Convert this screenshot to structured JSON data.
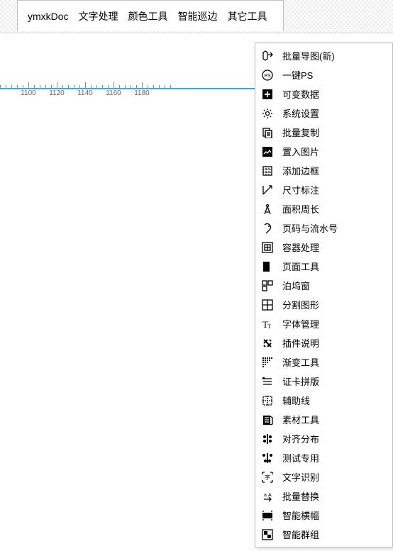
{
  "tab": {
    "doc_name": "ymxkDoc",
    "groups": [
      "文字处理",
      "颜色工具",
      "智能巡边",
      "其它工具"
    ]
  },
  "ruler": {
    "ticks": [
      1100,
      1120,
      1140,
      1160,
      1180
    ]
  },
  "menu": {
    "items": [
      {
        "icon": "export-icon",
        "label": "批量导图(新)"
      },
      {
        "icon": "ps-icon",
        "label": "一键PS"
      },
      {
        "icon": "plus-square-icon",
        "label": "可变数据"
      },
      {
        "icon": "gear-icon",
        "label": "系统设置"
      },
      {
        "icon": "copy-icon",
        "label": "批量复制"
      },
      {
        "icon": "place-image-icon",
        "label": "置入图片"
      },
      {
        "icon": "border-icon",
        "label": "添加边框"
      },
      {
        "icon": "dimension-icon",
        "label": "尺寸标注"
      },
      {
        "icon": "compass-icon",
        "label": "面积周长"
      },
      {
        "icon": "page-number-icon",
        "label": "页码与流水号"
      },
      {
        "icon": "container-icon",
        "label": "容器处理"
      },
      {
        "icon": "page-tool-icon",
        "label": "页面工具"
      },
      {
        "icon": "dock-icon",
        "label": "泊坞窗"
      },
      {
        "icon": "split-icon",
        "label": "分割图形"
      },
      {
        "icon": "font-icon",
        "label": "字体管理"
      },
      {
        "icon": "plugin-icon",
        "label": "插件说明"
      },
      {
        "icon": "gradient-icon",
        "label": "渐变工具"
      },
      {
        "icon": "card-icon",
        "label": "证卡拼版"
      },
      {
        "icon": "guide-icon",
        "label": "辅助线"
      },
      {
        "icon": "asset-icon",
        "label": "素材工具"
      },
      {
        "icon": "align-icon",
        "label": "对齐分布"
      },
      {
        "icon": "test-icon",
        "label": "测试专用"
      },
      {
        "icon": "ocr-icon",
        "label": "文字识别"
      },
      {
        "icon": "replace-icon",
        "label": "批量替换"
      },
      {
        "icon": "banner-icon",
        "label": "智能横幅"
      },
      {
        "icon": "group-icon",
        "label": "智能群组"
      }
    ]
  }
}
